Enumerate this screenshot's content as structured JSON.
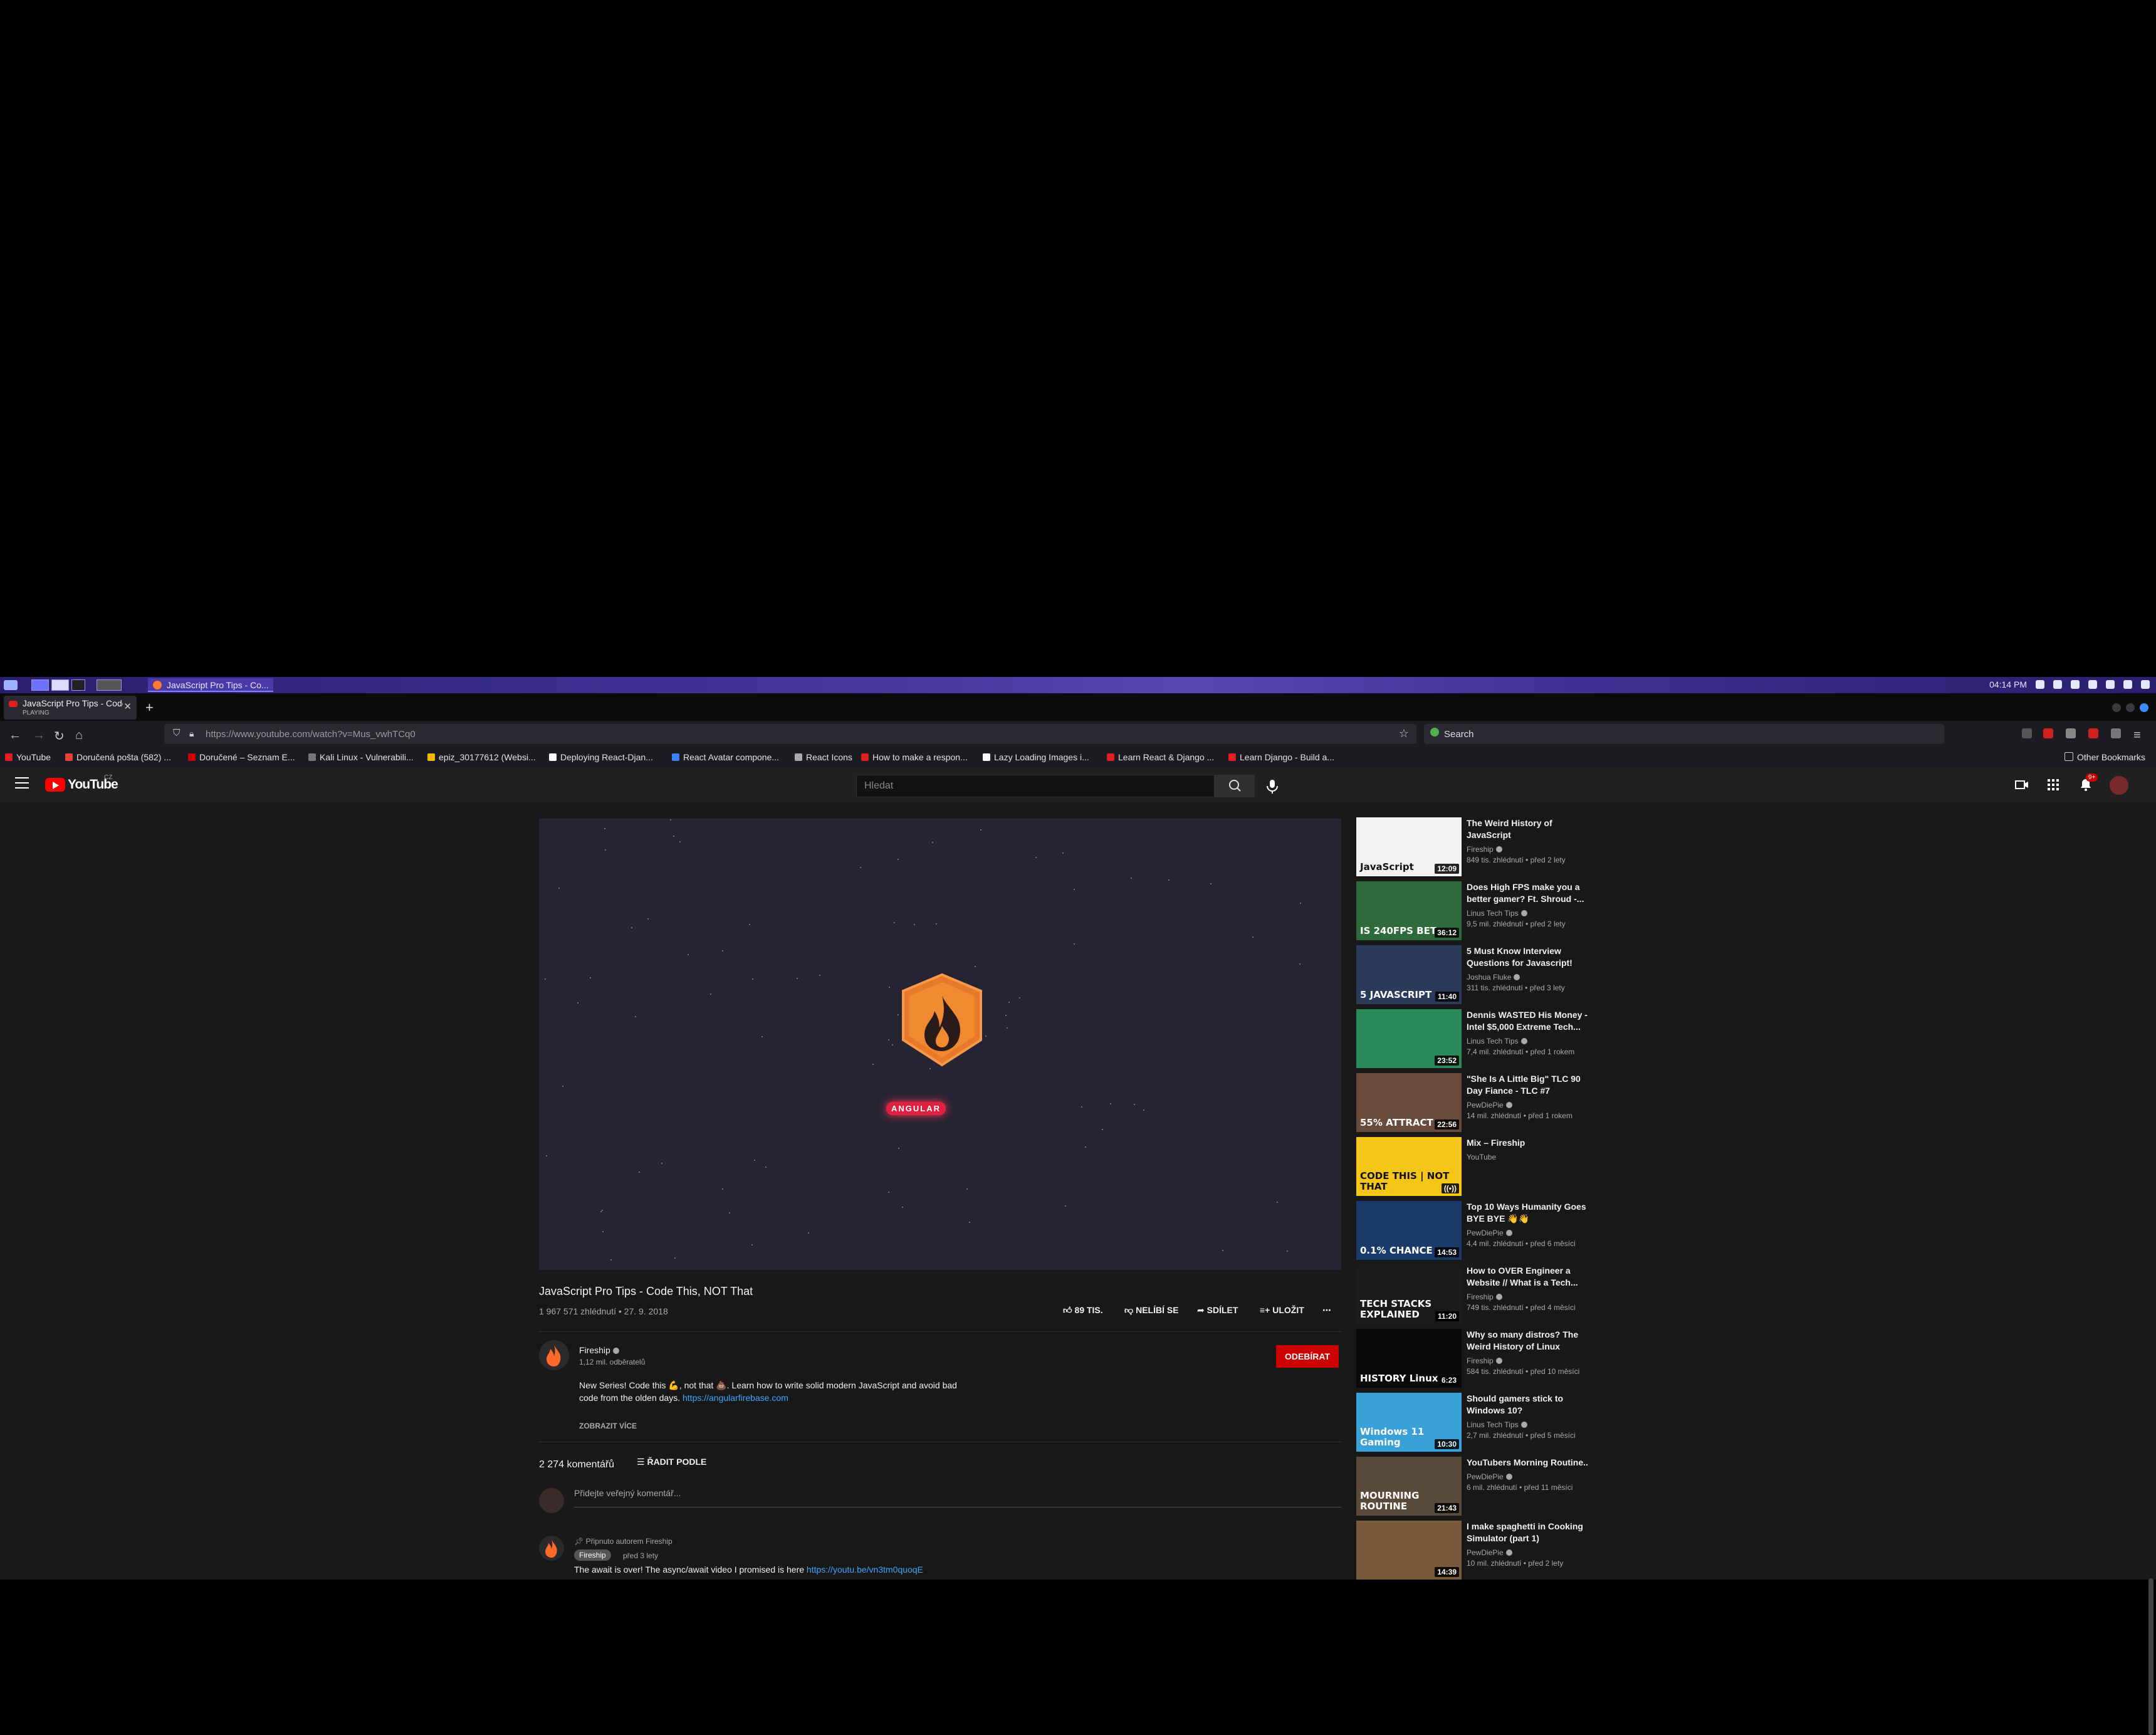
{
  "system_panel": {
    "task_title": "JavaScript Pro Tips - Co...",
    "clock": "04:14 PM"
  },
  "browser": {
    "tab": {
      "title": "JavaScript Pro Tips - Code...",
      "subtitle": "PLAYING"
    },
    "url": "https://www.youtube.com/watch?v=Mus_vwhTCq0",
    "search_placeholder": "Search",
    "bookmarks": [
      {
        "label": "YouTube",
        "color": "#e02020"
      },
      {
        "label": "Doručená pošta (582) ...",
        "color": "#ea4335"
      },
      {
        "label": "Doručené – Seznam E...",
        "color": "#cc0000"
      },
      {
        "label": "Kali Linux - Vulnerabili...",
        "color": "#777777"
      },
      {
        "label": "epiz_30177612 (Websi...",
        "color": "#f4b400"
      },
      {
        "label": "Deploying React-Djan...",
        "color": "#ffffff"
      },
      {
        "label": "React Avatar compone...",
        "color": "#3b82f6"
      },
      {
        "label": "React Icons",
        "color": "#aaaaaa"
      },
      {
        "label": "How to make a respon...",
        "color": "#e02020"
      },
      {
        "label": "Lazy Loading Images i...",
        "color": "#ffffff"
      },
      {
        "label": "Learn React & Django ...",
        "color": "#e02020"
      },
      {
        "label": "Learn Django - Build a...",
        "color": "#e02020"
      }
    ],
    "other_bookmarks": "Other Bookmarks"
  },
  "youtube": {
    "logo_text": "YouTube",
    "logo_region": "CZ",
    "search_placeholder": "Hledat",
    "notification_count": "9+",
    "video": {
      "title": "JavaScript Pro Tips - Code This, NOT That",
      "meta": "1 967 571 zhlédnutí • 27. 9. 2018",
      "likes": "89 TIS.",
      "dislike": "NELÍBÍ SE",
      "share": "SDÍLET",
      "save": "ULOŽIT",
      "player_logo_text": "ANGULAR"
    },
    "channel": {
      "name": "Fireship",
      "subs": "1,12 mil. odběratelů",
      "subscribe": "ODEBÍRAT"
    },
    "description": {
      "text": "New Series! Code this 💪, not that 💩. Learn how to write solid modern JavaScript and avoid bad code from the olden days.",
      "link": "https://angularfirebase.com",
      "more": "ZOBRAZIT VÍCE"
    },
    "comments": {
      "count": "2 274 komentářů",
      "sort": "ŘADIT PODLE",
      "placeholder": "Přidejte veřejný komentář...",
      "pinned_label": "Připnuto autorem Fireship",
      "first": {
        "author": "Fireship",
        "time": "před 3 lety",
        "text": "The await is over! The async/await video I promised is here",
        "link": "https://youtu.be/vn3tm0quoqE"
      }
    },
    "recommendations": [
      {
        "title": "The Weird History of JavaScript",
        "channel": "Fireship",
        "meta": "849 tis. zhlédnutí • před 2 lety",
        "duration": "12:09",
        "thumb": "#f2f2f2",
        "label": "JavaScript"
      },
      {
        "title": "Does High FPS make you a better gamer? Ft. Shroud -...",
        "channel": "Linus Tech Tips",
        "meta": "9,5 mil. zhlédnutí • před 2 lety",
        "duration": "36:12",
        "thumb": "#2f6b3a",
        "label": "IS 240FPS BET"
      },
      {
        "title": "5 Must Know Interview Questions for Javascript!",
        "channel": "Joshua Fluke",
        "meta": "311 tis. zhlédnutí • před 3 lety",
        "duration": "11:40",
        "thumb": "#2a3a5a",
        "label": "5 JAVASCRIPT"
      },
      {
        "title": "Dennis WASTED His Money - Intel $5,000 Extreme Tech...",
        "channel": "Linus Tech Tips",
        "meta": "7,4 mil. zhlédnutí • před 1 rokem",
        "duration": "23:52",
        "thumb": "#2a8a5a",
        "label": ""
      },
      {
        "title": "\"She Is A Little Big\" TLC 90 Day Fiance - TLC #7",
        "channel": "PewDiePie",
        "meta": "14 mil. zhlédnutí • před 1 rokem",
        "duration": "22:56",
        "thumb": "#6a4a3a",
        "label": "55% ATTRACT"
      },
      {
        "title": "Mix – Fireship",
        "channel": "YouTube",
        "meta": "",
        "duration": "",
        "thumb": "#f5c518",
        "label": "CODE THIS | NOT THAT"
      },
      {
        "title": "Top 10 Ways Humanity Goes BYE BYE 👋👋",
        "channel": "PewDiePie",
        "meta": "4,4 mil. zhlédnutí • před 6 měsíci",
        "duration": "14:53",
        "thumb": "#1a3a6a",
        "label": "0.1% CHANCE"
      },
      {
        "title": "How to OVER Engineer a Website // What is a Tech...",
        "channel": "Fireship",
        "meta": "749 tis. zhlédnutí • před 4 měsíci",
        "duration": "11:20",
        "thumb": "#1a1a1a",
        "label": "TECH STACKS EXPLAINED"
      },
      {
        "title": "Why so many distros? The Weird History of Linux",
        "channel": "Fireship",
        "meta": "584 tis. zhlédnutí • před 10 měsíci",
        "duration": "6:23",
        "thumb": "#0a0a0a",
        "label": "HISTORY Linux"
      },
      {
        "title": "Should gamers stick to Windows 10?",
        "channel": "Linus Tech Tips",
        "meta": "2,7 mil. zhlédnutí • před 5 měsíci",
        "duration": "10:30",
        "thumb": "#3aa0d8",
        "label": "Windows 11 Gaming"
      },
      {
        "title": "YouTubers Morning Routine..",
        "channel": "PewDiePie",
        "meta": "6 mil. zhlédnutí • před 11 měsíci",
        "duration": "21:43",
        "thumb": "#5a4a3a",
        "label": "MOURNING ROUTINE"
      },
      {
        "title": "I make spaghetti in Cooking Simulator (part 1)",
        "channel": "PewDiePie",
        "meta": "10 mil. zhlédnutí • před 2 lety",
        "duration": "14:39",
        "thumb": "#7a5a3a",
        "label": ""
      }
    ]
  }
}
